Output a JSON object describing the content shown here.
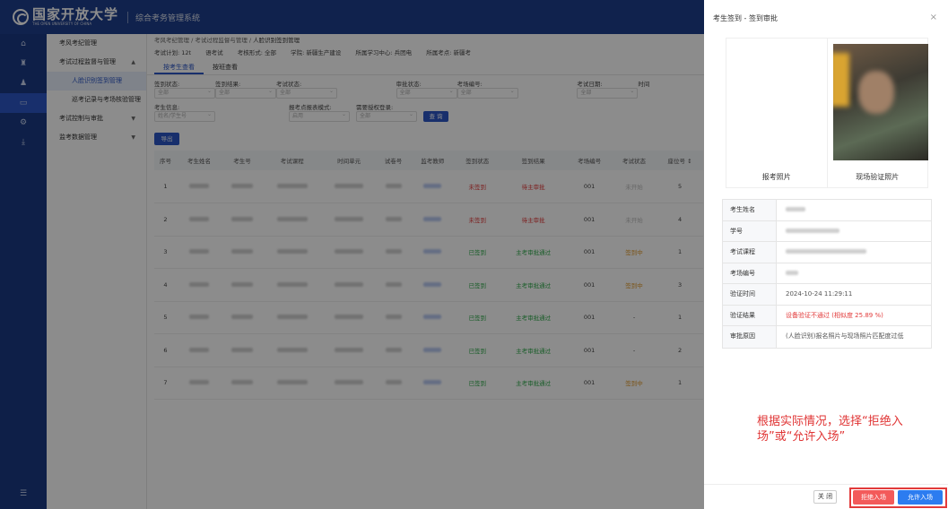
{
  "header": {
    "university_cn": "国家开放大学",
    "university_en": "THE OPEN UNIVERSITY OF CHINA",
    "system_name": "综合考务管理系统"
  },
  "rail_icons": [
    "home-icon",
    "grad-icon",
    "user-icon",
    "monitor-icon",
    "settings-icon",
    "download-icon"
  ],
  "sidebar": {
    "items": [
      {
        "label": "考风考纪管理",
        "chev": ""
      },
      {
        "label": "考试过程监督与管理",
        "chev": "▲"
      },
      {
        "label": "人脸识别签到管理",
        "chev": ""
      },
      {
        "label": "巡考记录与考场核验管理",
        "chev": ""
      },
      {
        "label": "考试控制与审批",
        "chev": "▼"
      },
      {
        "label": "监考数据管理",
        "chev": "▼"
      }
    ]
  },
  "breadcrumb": {
    "part1": "考风考纪管理",
    "sep": " / ",
    "part2": "考试过程监督与管理",
    "current": "人脸识别签到管理"
  },
  "infoline": {
    "plan": "考试计划: 12t",
    "exam_type": "语考试",
    "form": "考核形式: 全部",
    "school": "学院: 新疆生产建设",
    "center": "所属学习中心: 兵团电",
    "site": "所属考点: 新疆考"
  },
  "tabs": [
    "按考生查看",
    "按班查看"
  ],
  "filters": {
    "row1": [
      {
        "label": "签到状态:",
        "value": "全部"
      },
      {
        "label": "签到结果:",
        "value": "全部"
      },
      {
        "label": "考试状态:",
        "value": "全部"
      },
      {
        "label": "",
        "value": ""
      },
      {
        "label": "审批状态:",
        "value": "全部"
      },
      {
        "label": "考场编号:",
        "value": "全部"
      },
      {
        "label": "",
        "value": ""
      },
      {
        "label": "考试日期:",
        "value": "全部"
      },
      {
        "label": "时间",
        "value": ""
      }
    ],
    "row2": [
      {
        "label": "考生信息:",
        "value": "姓名/学生号"
      },
      {
        "label": "",
        "value": ""
      },
      {
        "label": "报考点报表模式:",
        "value": "启用"
      },
      {
        "label": "需要授权登录:",
        "value": "全部"
      }
    ],
    "search_label": "查 询"
  },
  "export_label": "导出",
  "table": {
    "headers": [
      "序号",
      "考生姓名",
      "考生号",
      "考试课程",
      "时间单元",
      "试卷号",
      "监考教师",
      "签到状态",
      "签到结果",
      "考场编号",
      "考试状态",
      "座位号 ↕"
    ],
    "rows": [
      {
        "idx": "1",
        "status": "未签到",
        "result": "待主审批",
        "room": "001",
        "exam": "未开始",
        "seat": "5",
        "status_cls": "st-red",
        "result_cls": "st-red",
        "exam_cls": "st-gray"
      },
      {
        "idx": "2",
        "status": "未签到",
        "result": "待主审批",
        "room": "001",
        "exam": "未开始",
        "seat": "4",
        "status_cls": "st-red",
        "result_cls": "st-red",
        "exam_cls": "st-gray"
      },
      {
        "idx": "3",
        "status": "已签到",
        "result": "主考审批通过",
        "room": "001",
        "exam": "签到中",
        "seat": "1",
        "status_cls": "st-green",
        "result_cls": "st-green",
        "exam_cls": "st-orange"
      },
      {
        "idx": "4",
        "status": "已签到",
        "result": "主考审批通过",
        "room": "001",
        "exam": "签到中",
        "seat": "3",
        "status_cls": "st-green",
        "result_cls": "st-green",
        "exam_cls": "st-orange"
      },
      {
        "idx": "5",
        "status": "已签到",
        "result": "主考审批通过",
        "room": "001",
        "exam": "-",
        "seat": "1",
        "status_cls": "st-green",
        "result_cls": "st-green",
        "exam_cls": ""
      },
      {
        "idx": "6",
        "status": "已签到",
        "result": "主考审批通过",
        "room": "001",
        "exam": "-",
        "seat": "2",
        "status_cls": "st-green",
        "result_cls": "st-green",
        "exam_cls": ""
      },
      {
        "idx": "7",
        "status": "已签到",
        "result": "主考审批通过",
        "room": "001",
        "exam": "签到中",
        "seat": "1",
        "status_cls": "st-green",
        "result_cls": "st-green",
        "exam_cls": "st-orange"
      }
    ]
  },
  "panel": {
    "title": "考生签到 - 签到审批",
    "close_icon": "×",
    "photo_registered": "报考照片",
    "photo_live": "现场验证照片",
    "rows": [
      {
        "key": "考生姓名",
        "value": ""
      },
      {
        "key": "学号",
        "value": ""
      },
      {
        "key": "考试课程",
        "value": ""
      },
      {
        "key": "考场编号",
        "value": ""
      },
      {
        "key": "验证时间",
        "value": "2024-10-24 11:29:11"
      },
      {
        "key": "验证结果",
        "value": "设备验证不通过  (相似度 25.89 %)"
      },
      {
        "key": "审批原因",
        "value": "(人脸识别)报名照片与现场照片匹配度过低"
      }
    ],
    "annotation": "根据实际情况，选择“拒绝入场”或“允许入场”",
    "btn_close": "关 闭",
    "btn_reject": "拒绝入场",
    "btn_allow": "允许入场"
  },
  "colors": {
    "header_bg": "#1e3e8c",
    "primary": "#2c57c5",
    "reject": "#f35a5a",
    "allow": "#2c7cf0",
    "annotation": "#e03434"
  }
}
